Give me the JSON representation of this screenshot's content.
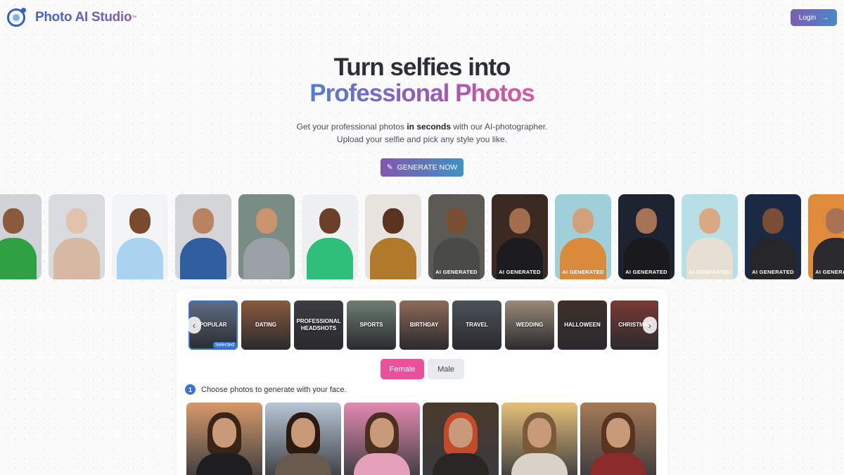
{
  "header": {
    "brand": "Photo AI Studio",
    "brand_tm": "™",
    "login_label": "Login",
    "login_icon": "arrow-right-icon"
  },
  "hero": {
    "title_line1": "Turn selfies into",
    "title_line2": "Professional Photos",
    "subtitle_line1_pre": "Get your professional photos ",
    "subtitle_line1_bold": "in seconds",
    "subtitle_line1_post": " with our AI-photographer.",
    "subtitle_line2": "Upload your selfie and pick any style you like.",
    "cta_label": "GENERATE NOW",
    "cta_icon": "magic-wand-icon"
  },
  "strip": {
    "ai_label": "AI GENERATED",
    "photos": [
      {
        "kind": "selfie",
        "bg": "#cfd2d6",
        "skin": "#8a5a3c",
        "top": "#2ea043"
      },
      {
        "kind": "selfie",
        "bg": "#d9dcdf",
        "skin": "#e2c2ad",
        "top": "#d6b8a3"
      },
      {
        "kind": "selfie",
        "bg": "#f2f3f5",
        "skin": "#7a4a2d",
        "top": "#a9d3ee"
      },
      {
        "kind": "selfie",
        "bg": "#d3d5d8",
        "skin": "#b98260",
        "top": "#2f5f9e"
      },
      {
        "kind": "selfie",
        "bg": "#7a8c86",
        "skin": "#c9946e",
        "top": "#9aa0a6"
      },
      {
        "kind": "selfie",
        "bg": "#eef0f2",
        "skin": "#6b4028",
        "top": "#2fbf7a"
      },
      {
        "kind": "selfie",
        "bg": "#e7e4e0",
        "skin": "#5a3420",
        "top": "#b07a2a"
      },
      {
        "kind": "ai",
        "bg": "#5b5a54",
        "skin": "#7a4e33",
        "top": "#4a4a48"
      },
      {
        "kind": "ai",
        "bg": "#3a2a22",
        "skin": "#a26d4d",
        "top": "#1c1c1e"
      },
      {
        "kind": "ai",
        "bg": "#9fd0da",
        "skin": "#d0a07a",
        "top": "#d98a3a"
      },
      {
        "kind": "ai",
        "bg": "#1d2330",
        "skin": "#a57255",
        "top": "#1a1a1c"
      },
      {
        "kind": "ai",
        "bg": "#b9dfe6",
        "skin": "#d9a884",
        "top": "#e8e0d2"
      },
      {
        "kind": "ai",
        "bg": "#1b2a44",
        "skin": "#7a4e36",
        "top": "#262628"
      },
      {
        "kind": "ai",
        "bg": "#e08a3c",
        "skin": "#a87250",
        "top": "#2a2a2c"
      }
    ]
  },
  "categories": [
    {
      "label": "POPULAR",
      "selected": true,
      "bg": "#5f6f86"
    },
    {
      "label": "DATING",
      "selected": false,
      "bg": "#8a5a3e"
    },
    {
      "label": "PROFESSIONAL HEADSHOTS",
      "selected": false,
      "bg": "#3a3c42"
    },
    {
      "label": "SPORTS",
      "selected": false,
      "bg": "#6e7d72"
    },
    {
      "label": "BIRTHDAY",
      "selected": false,
      "bg": "#8e6a58"
    },
    {
      "label": "TRAVEL",
      "selected": false,
      "bg": "#4c5258"
    },
    {
      "label": "WEDDING",
      "selected": false,
      "bg": "#9a8a78"
    },
    {
      "label": "HALLOWEEN",
      "selected": false,
      "bg": "#3e2f2a"
    },
    {
      "label": "CHRISTMAS",
      "selected": false,
      "bg": "#7a3a34"
    }
  ],
  "category_selected_badge": "Selected",
  "gender": {
    "female_label": "Female",
    "male_label": "Male"
  },
  "step": {
    "number": "1",
    "text": "Choose photos to generate with your face."
  },
  "gallery": [
    {
      "bg": "#d79a6a",
      "hair": "#3a2418",
      "top": "#1e1e20"
    },
    {
      "bg": "#b8c7d6",
      "hair": "#2a1a12",
      "top": "#6a5a4e"
    },
    {
      "bg": "#e58ab0",
      "hair": "#4a2e20",
      "top": "#e3a0b8"
    },
    {
      "bg": "#4a3a2c",
      "hair": "#c44a2a",
      "top": "#2a2624"
    },
    {
      "bg": "#e7c07a",
      "hair": "#7a5a3a",
      "top": "#d8d2c8"
    },
    {
      "bg": "#a87a58",
      "hair": "#5a3420",
      "top": "#8a2a2a"
    }
  ]
}
